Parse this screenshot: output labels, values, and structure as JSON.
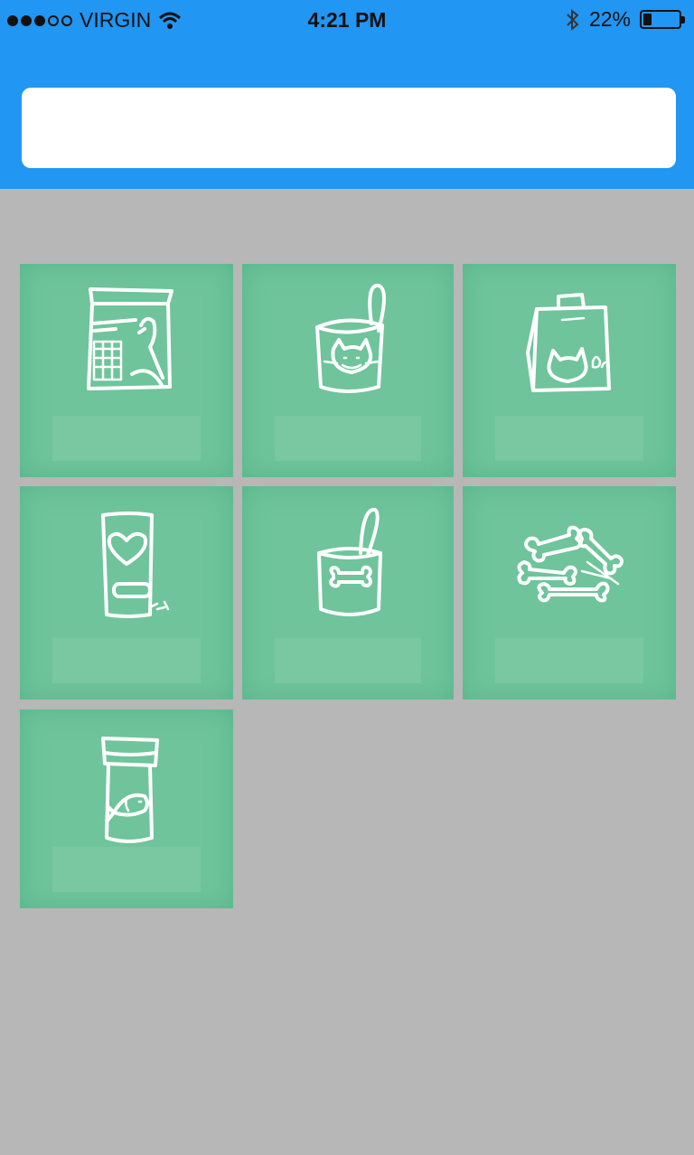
{
  "status_bar": {
    "carrier": "VIRGIN",
    "time": "4:21 PM",
    "battery": "22%",
    "battery_level": 0.22
  },
  "search": {
    "placeholder": "",
    "value": ""
  },
  "colors": {
    "header": "#2196f3",
    "tile": "#6fc49b",
    "background": "#b7b7b7"
  },
  "tiles": [
    {
      "icon": "bird-seed-bag-icon",
      "label": ""
    },
    {
      "icon": "cat-food-can-icon",
      "label": ""
    },
    {
      "icon": "cat-food-bag-icon",
      "label": ""
    },
    {
      "icon": "pet-treat-bag-icon",
      "label": ""
    },
    {
      "icon": "dog-food-can-icon",
      "label": ""
    },
    {
      "icon": "dog-bones-icon",
      "label": ""
    },
    {
      "icon": "fish-food-jar-icon",
      "label": ""
    }
  ]
}
